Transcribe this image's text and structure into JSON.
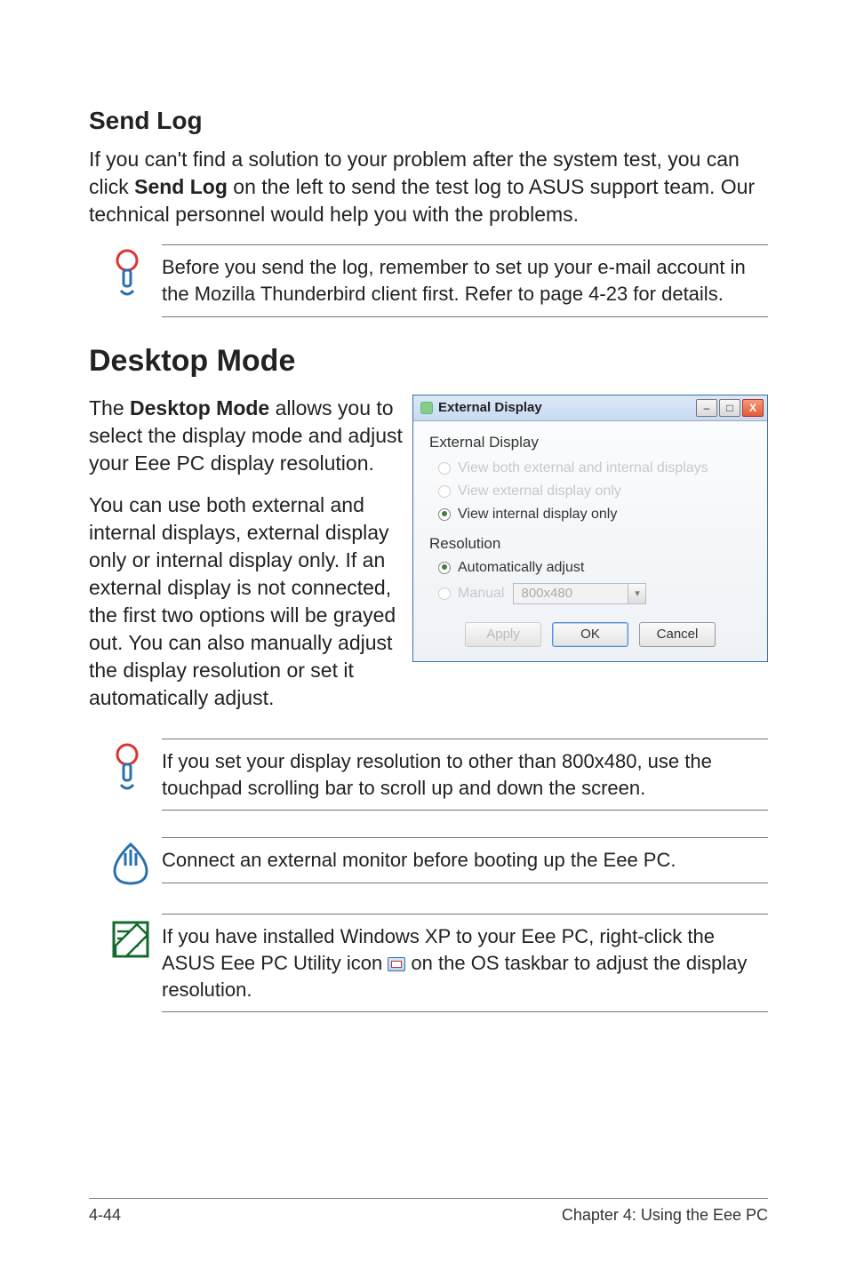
{
  "sendlog": {
    "heading": "Send Log",
    "para_a": "If you can't find a solution to your problem after the system test, you can click ",
    "para_bold": "Send Log",
    "para_b": " on the left to send the test log to ASUS support team. Our technical personnel would help you with the problems.",
    "tip": "Before you send the log, remember to set up your e-mail account in the Mozilla Thunderbird client first. Refer to page 4-23 for details."
  },
  "desktop": {
    "heading": "Desktop Mode",
    "para1_a": "The ",
    "para1_bold": "Desktop Mode",
    "para1_b": " allows you to select the display mode and adjust your Eee PC display resolution.",
    "para2": "You can use both external and internal displays, external display only or internal display only. If an external display is not connected, the first two options will be grayed out. You can also manually adjust the display resolution or set it automatically adjust."
  },
  "external_display_window": {
    "title": "External Display",
    "group1": "External Display",
    "opt_both": "View both external and internal displays",
    "opt_ext": "View external display only",
    "opt_int": "View internal display only",
    "group2": "Resolution",
    "opt_auto": "Automatically adjust",
    "opt_manual": "Manual",
    "combo_value": "800x480",
    "btn_apply": "Apply",
    "btn_ok": "OK",
    "btn_cancel": "Cancel",
    "win_min": "–",
    "win_max": "□",
    "win_close": "X",
    "combo_arrow": "▾"
  },
  "notes": {
    "scroll": "If you set your display resolution to other than 800x480, use the touchpad scrolling bar to scroll up and down the screen.",
    "connect": "Connect an external monitor before booting up the Eee PC.",
    "xp_a": "If you have installed Windows XP to your Eee PC, right-click the ASUS Eee PC Utility icon ",
    "xp_b": " on the OS taskbar to adjust the display resolution."
  },
  "footer": {
    "left": "4-44",
    "right": "Chapter 4: Using the Eee PC"
  }
}
